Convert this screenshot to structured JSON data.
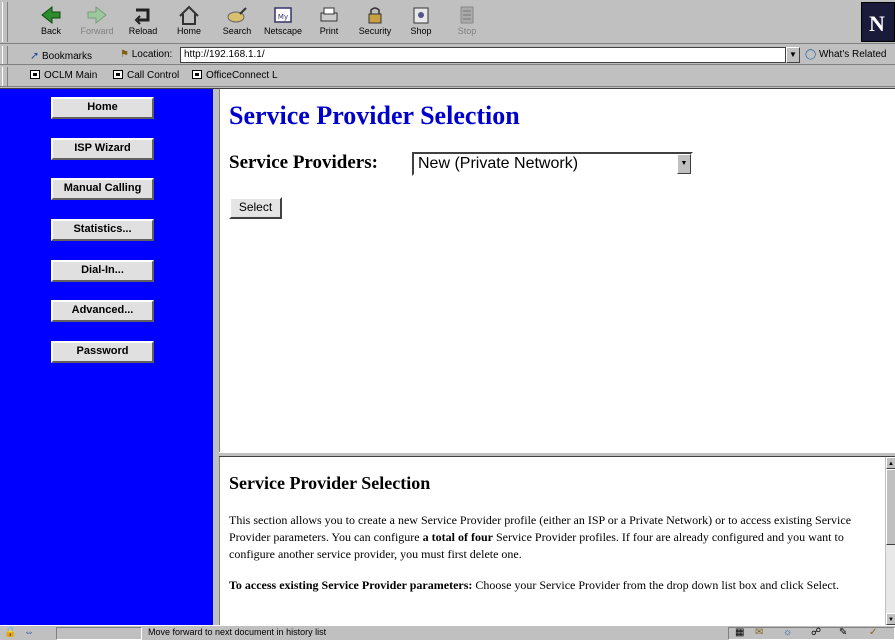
{
  "toolbar": {
    "buttons": [
      {
        "label": "Back",
        "icon": "back-arrow-icon",
        "enabled": true
      },
      {
        "label": "Forward",
        "icon": "forward-arrow-icon",
        "enabled": false
      },
      {
        "label": "Reload",
        "icon": "reload-icon",
        "enabled": true
      },
      {
        "label": "Home",
        "icon": "home-icon",
        "enabled": true
      },
      {
        "label": "Search",
        "icon": "search-icon",
        "enabled": true
      },
      {
        "label": "Netscape",
        "icon": "netscape-icon",
        "enabled": true
      },
      {
        "label": "Print",
        "icon": "print-icon",
        "enabled": true
      },
      {
        "label": "Security",
        "icon": "lock-icon",
        "enabled": true
      },
      {
        "label": "Shop",
        "icon": "shop-icon",
        "enabled": true
      },
      {
        "label": "Stop",
        "icon": "stop-icon",
        "enabled": false
      }
    ],
    "logo": "N"
  },
  "location_bar": {
    "bookmarks_label": "Bookmarks",
    "location_label": "Location:",
    "url": "http://192.168.1.1/",
    "whats_related": "What's Related"
  },
  "personal_toolbar": {
    "items": [
      "OCLM Main",
      "Call Control",
      "OfficeConnect L"
    ]
  },
  "sidebar": {
    "items": [
      "Home",
      "ISP Wizard",
      "Manual Calling",
      "Statistics...",
      "Dial-In...",
      "Advanced...",
      "Password"
    ]
  },
  "main": {
    "title": "Service Provider Selection",
    "providers_label": "Service Providers:",
    "providers_selected": "New (Private Network)",
    "select_button": "Select"
  },
  "help": {
    "title": "Service Provider Selection",
    "para1_a": "This section allows you to create a new Service Provider profile (either an ISP or a Private Network) or to access existing Service Provider parameters. You can configure ",
    "para1_bold": "a total of four",
    "para1_b": " Service Provider profiles. If four are already configured and you want to configure another service provider, you must first delete one.",
    "para2_bold": "To access existing Service Provider parameters:",
    "para2_text": " Choose your Service Provider from the drop down list box and click Select."
  },
  "status_bar": {
    "message": "Move forward to next document in history list"
  },
  "colors": {
    "sidebar_bg": "#0000ff",
    "title_blue": "#0000cc"
  }
}
